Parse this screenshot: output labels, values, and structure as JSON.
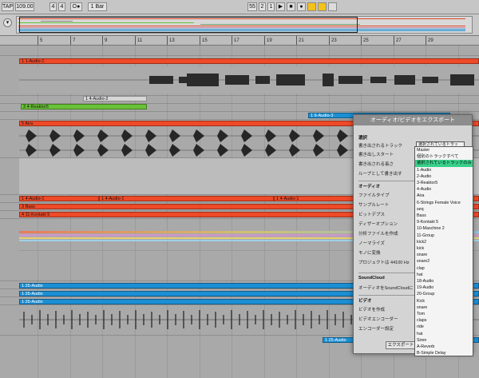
{
  "transport": {
    "tap": "TAP",
    "tempo": "109.00",
    "sig_num": "4",
    "sig_den": "4",
    "metro": "O●",
    "quantize": "1 Bar",
    "pos_bar": "55",
    "pos_beat": "2",
    "pos_sub": "1",
    "play_icon": "▶",
    "stop_icon": "■",
    "rec_icon": "●"
  },
  "ruler": [
    "5",
    "7",
    "9",
    "11",
    "13",
    "15",
    "17",
    "19",
    "21",
    "23",
    "25",
    "27",
    "29"
  ],
  "clips": [
    {
      "name": "1-Audio-1",
      "label": "1 1-Audio-1"
    },
    {
      "name": "4-Audio-2",
      "label": "1 4-Audio-2"
    },
    {
      "name": "4-Reaktor5",
      "label": "3 4-Reaktor5"
    },
    {
      "name": "6-Audio-3",
      "label": "1 6-Audio-3"
    },
    {
      "name": "Aira",
      "label": "5 Aira"
    },
    {
      "name": "4-Audio-1a",
      "label": "1 4-Audio-1"
    },
    {
      "name": "4-Audio-1b",
      "label": "1 4-Audio-1"
    },
    {
      "name": "4-Audio-1c",
      "label": "1 4-Audio-1"
    },
    {
      "name": "Bass",
      "label": "3 Bass"
    },
    {
      "name": "11-Kontakt5",
      "label": "4 11-Kontakt 5"
    },
    {
      "name": "25-Audio-a",
      "label": "1 25-Audio"
    },
    {
      "name": "25-Audio-b",
      "label": "1 25-Audio"
    },
    {
      "name": "25-Audio-c",
      "label": "1 25-Audio"
    },
    {
      "name": "25-Audio-d",
      "label": "1 25-Audio"
    }
  ],
  "dialog": {
    "title": "オーディオ/ビデオをエクスポート",
    "sec_select": "選択",
    "rows": [
      "書き出されるトラック",
      "書き出しスタート",
      "書き出される長さ",
      "ループとして書き出す"
    ],
    "selected_value": "選択されているトラッ",
    "sec_audio": "オーディオ",
    "audio_rows": [
      "ファイルタイプ",
      "サンプルレート",
      "ビットデプス",
      "ディザーオプション",
      "分析ファイルを作成",
      "ノーマライズ",
      "モノに変換",
      "プロジェクトは 44100 Hz"
    ],
    "sec_soundcloud": "SoundCloud",
    "soundcloud_row": "オーディオをSoundCloudに",
    "sec_video": "ビデオ",
    "video_rows": [
      "ビデオを作成",
      "ビデオエンコーダー",
      "エンコーダー設定"
    ],
    "export_label": "エクスポート"
  },
  "dropdown": {
    "options": [
      "Master",
      "個別のトラックすべて",
      "選択されているトラックのみ",
      "1-Audio",
      "2-Audio",
      "3-Reaktor5",
      "4-Audio",
      "Aira",
      "6-Strings Female Voice",
      "seq",
      "Bass",
      "9-Kontakt 5",
      "10-Maschine 2",
      "11-Group",
      "kick2",
      "kick",
      "snare",
      "snare2",
      "clap",
      "hat",
      "18-Audio",
      "19-Audio",
      "20-Group",
      "Kick",
      "snare",
      "Tom",
      "claps",
      "ride",
      "hat",
      "Siren",
      "A-Reverb",
      "B-Simple Delay"
    ],
    "selected_index": 2
  },
  "colors": {
    "clip_red": "#ef4a28",
    "clip_green": "#69c236",
    "clip_blue": "#1c8fd4",
    "selected_option": "#3ad08a"
  }
}
